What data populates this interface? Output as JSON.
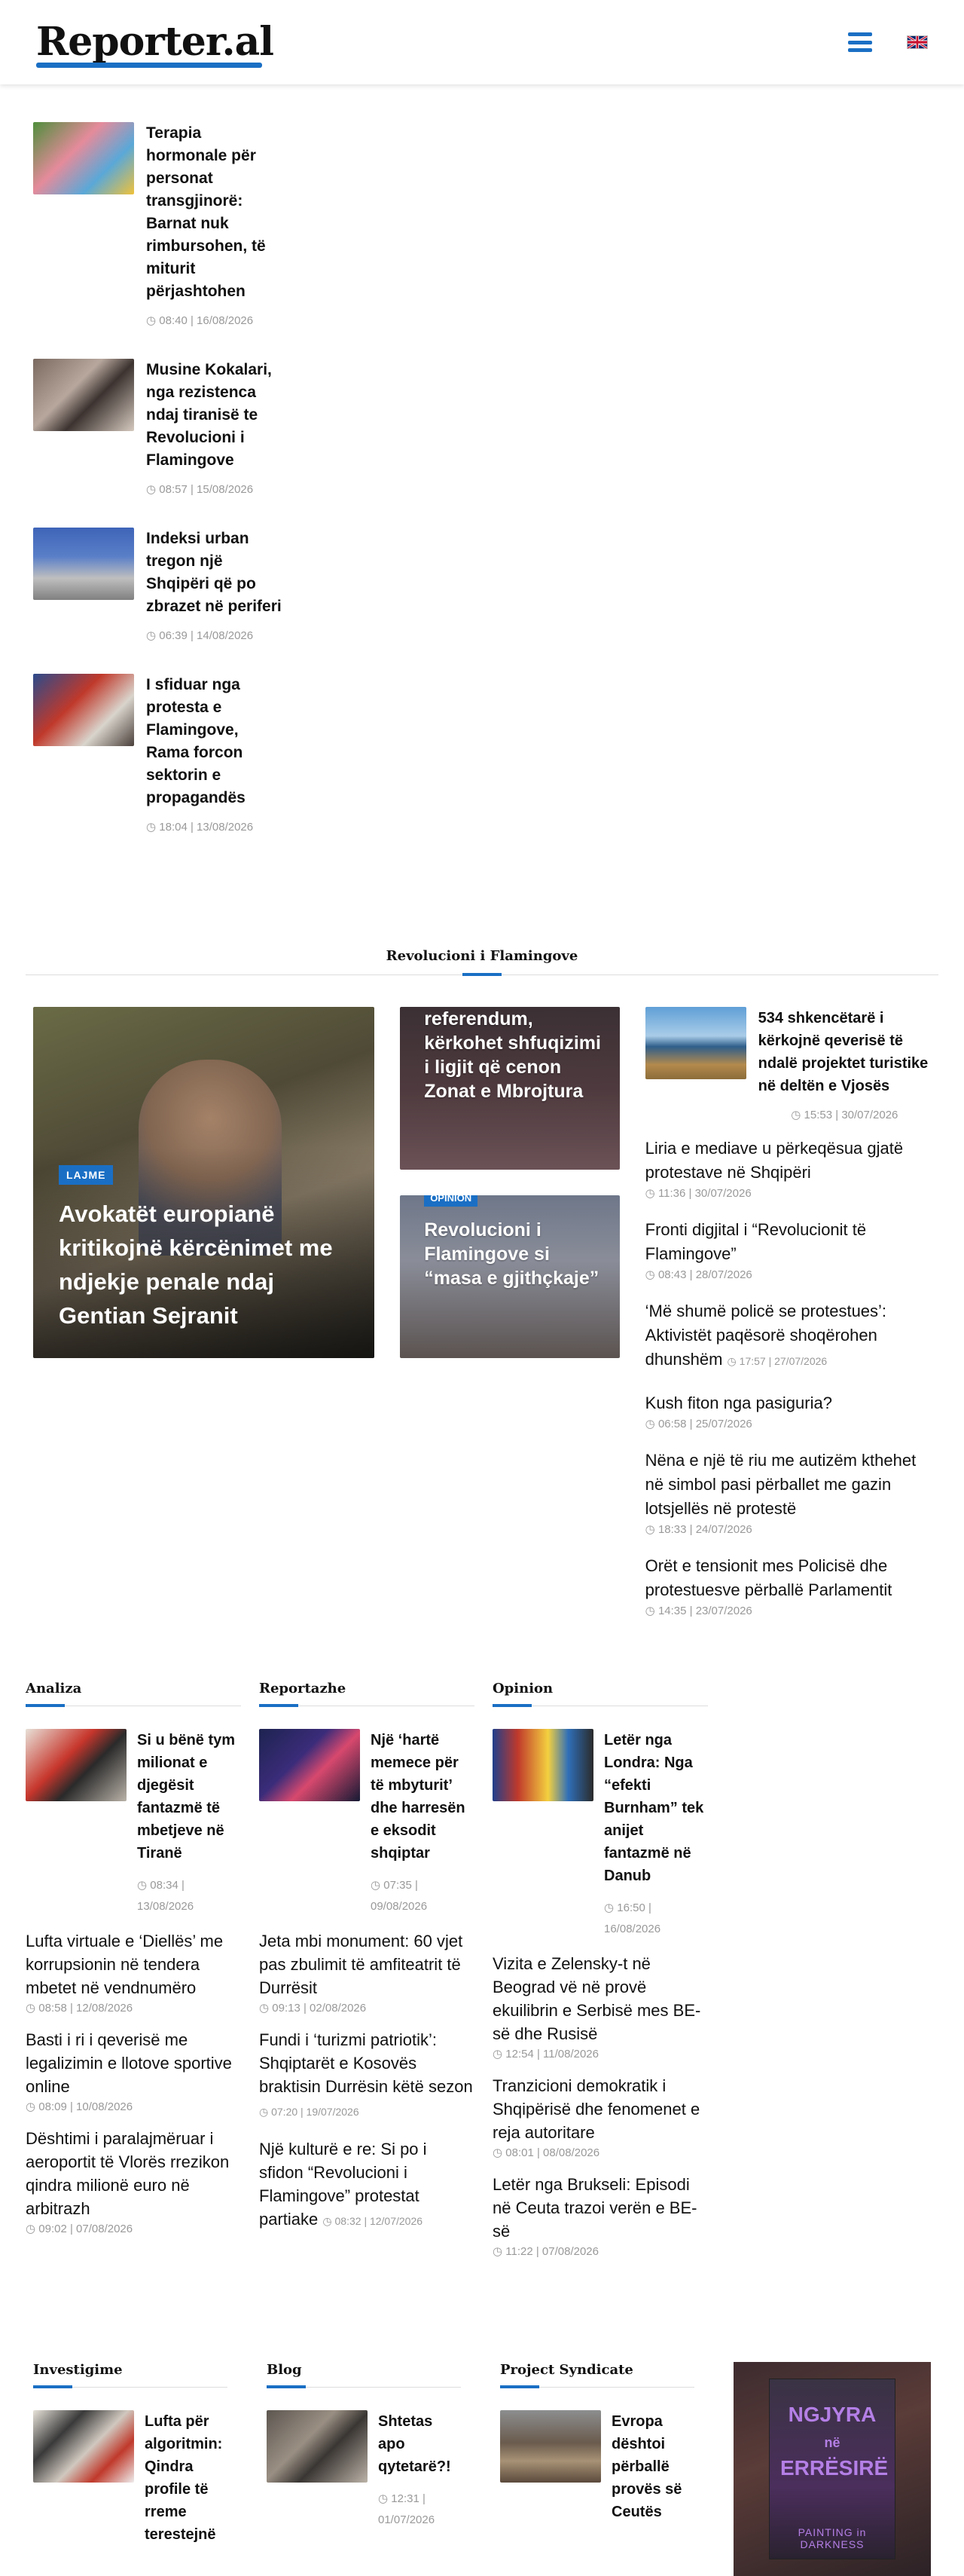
{
  "header": {
    "logo": "Reporter.al",
    "menu_icon": "hamburger-icon",
    "language_flag": "uk-flag-icon"
  },
  "top_list": [
    {
      "title": "Terapia hormonale për personat transgjinorë: Barnat nuk rimbursohen, të miturit përjashtohen",
      "meta": "08:40 | 16/08/2026"
    },
    {
      "title": "Musine Kokalari, nga rezistenca ndaj tiranisë te Revolucioni i Flamingove",
      "meta": "08:57 | 15/08/2026"
    },
    {
      "title": "Indeksi urban tregon një Shqipëri që po zbrazet në periferi",
      "meta": "06:39 | 14/08/2026"
    },
    {
      "title": "I sfiduar nga protesta e Flamingove, Rama forcon sektorin e propagandës",
      "meta": "18:04 | 13/08/2026"
    }
  ],
  "section": {
    "title": "Revolucioni i Flamingove"
  },
  "featured": {
    "big": {
      "tag": "LAJME",
      "title": "Avokatët europianë kritikojnë kërcënimet me ndjekje penale ndaj Gentian Sejranit"
    },
    "mid_a": {
      "title": "referendum, kërkohet shfuqizimi i ligjit që cenon Zonat e Mbrojtura"
    },
    "mid_b": {
      "tag": "OPINION",
      "title": "Revolucioni i Flamingove si “masa e gjithçkaje”"
    },
    "right_first": {
      "title": "534 shkencëtarë i kërkojnë qeverisë të ndalë projektet turistike në deltën e Vjosës",
      "meta": "15:53 | 30/07/2026"
    },
    "right_items": [
      {
        "title": "Liria e mediave u përkeqësua gjatë protestave në Shqipëri",
        "meta": "11:36 | 30/07/2026"
      },
      {
        "title": "Fronti digjital i “Revolucionit të Flamingove”",
        "meta": "08:43 | 28/07/2026"
      },
      {
        "title": "‘Më shumë policë se protestues’: Aktivistët paqësorë shoqërohen dhunshëm",
        "meta": "17:57 | 27/07/2026"
      },
      {
        "title": "Kush fiton nga pasiguria?",
        "meta": "06:58 | 25/07/2026"
      },
      {
        "title": "Nëna e një të riu me autizëm kthehet në simbol pasi përballet me gazin lotsjellës në protestë",
        "meta": "18:33 | 24/07/2026"
      },
      {
        "title": "Orët e tensionit mes Policisë dhe protestuesve përballë Parlamentit",
        "meta": "14:35 | 23/07/2026"
      }
    ]
  },
  "categories": [
    {
      "title": "Analiza",
      "feature": {
        "title": "Si u bënë tym milionat e djegësit fantazmë të mbetjeve në Tiranë",
        "meta": "08:34 | 13/08/2026"
      },
      "items": [
        {
          "title": "Lufta virtuale e ‘Diellës’ me korrupsionin në tendera mbetet në vendnumëro",
          "meta": "08:58 | 12/08/2026"
        },
        {
          "title": "Basti i ri i qeverisë me legalizimin e llotove sportive online",
          "meta": "08:09 | 10/08/2026"
        },
        {
          "title": "Dështimi i paralajmëruar i aeroportit të Vlorës rrezikon qindra milionë euro në arbitrazh",
          "meta": "09:02 | 07/08/2026"
        }
      ]
    },
    {
      "title": "Reportazhe",
      "feature": {
        "title": "Një ‘hartë memece për të mbyturit’ dhe harresën e eksodit shqiptar",
        "meta": "07:35 | 09/08/2026"
      },
      "items": [
        {
          "title": "Jeta mbi monument: 60 vjet pas zbulimit të amfiteatrit të Durrësit",
          "meta": "09:13 | 02/08/2026"
        },
        {
          "title": "Fundi i ‘turizmi patriotik’: Shqiptarët e Kosovës braktisin Durrësin këtë sezon",
          "meta": "07:20 | 19/07/2026"
        },
        {
          "title": "Një kulturë e re: Si po i sfidon “Revolucioni i Flamingove” protestat partiake",
          "meta": "08:32 | 12/07/2026"
        }
      ]
    },
    {
      "title": "Opinion",
      "feature": {
        "title": "Letër nga Londra: Nga “efekti Burnham” tek anijet fantazmë në Danub",
        "meta": "16:50 | 16/08/2026"
      },
      "items": [
        {
          "title": "Vizita e Zelensky-t në Beograd vë në provë ekuilibrin e Serbisë mes BE-së dhe Rusisë",
          "meta": "12:54 | 11/08/2026"
        },
        {
          "title": "Tranzicioni demokratik i Shqipërisë dhe fenomenet e reja autoritare",
          "meta": "08:01 | 08/08/2026"
        },
        {
          "title": "Letër nga Brukseli: Episodi në Ceuta trazoi verën e BE-së",
          "meta": "11:22 | 07/08/2026"
        }
      ]
    }
  ],
  "bottom": [
    {
      "title": "Investigime",
      "feature": {
        "title": "Lufta për algoritmin: Qindra profile të rreme terestejnë"
      }
    },
    {
      "title": "Blog",
      "feature": {
        "title": "Shtetas apo qytetarë?!",
        "meta": "12:31 | 01/07/2026"
      }
    },
    {
      "title": "Project Syndicate",
      "feature": {
        "title": "Evropa dështoi përballë provës së Ceutës"
      }
    }
  ],
  "ad": {
    "line1": "NGJYRA",
    "line1b": "në",
    "line1c": "ERRËSIRË",
    "line2": "PAINTING in DARKNESS"
  }
}
